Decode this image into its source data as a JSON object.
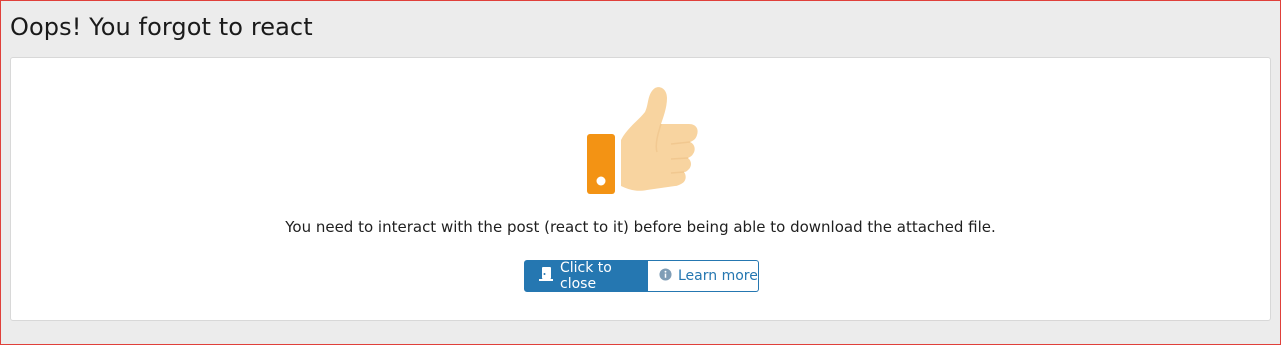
{
  "page": {
    "title": "Oops! You forgot to react"
  },
  "card": {
    "message": "You need to interact with the post (react to it) before being able to download the attached file.",
    "buttons": {
      "close_label": "Click to close",
      "learn_more_label": "Learn more"
    }
  },
  "icons": {
    "illustration": "thumbs-up-icon",
    "close": "door-exit-icon",
    "learn_more": "info-circle-icon"
  },
  "colors": {
    "primary": "#2577b1",
    "thumb_cuff": "#f39314",
    "thumb_skin": "#f8d4a0",
    "frame_border": "#e0403a"
  }
}
